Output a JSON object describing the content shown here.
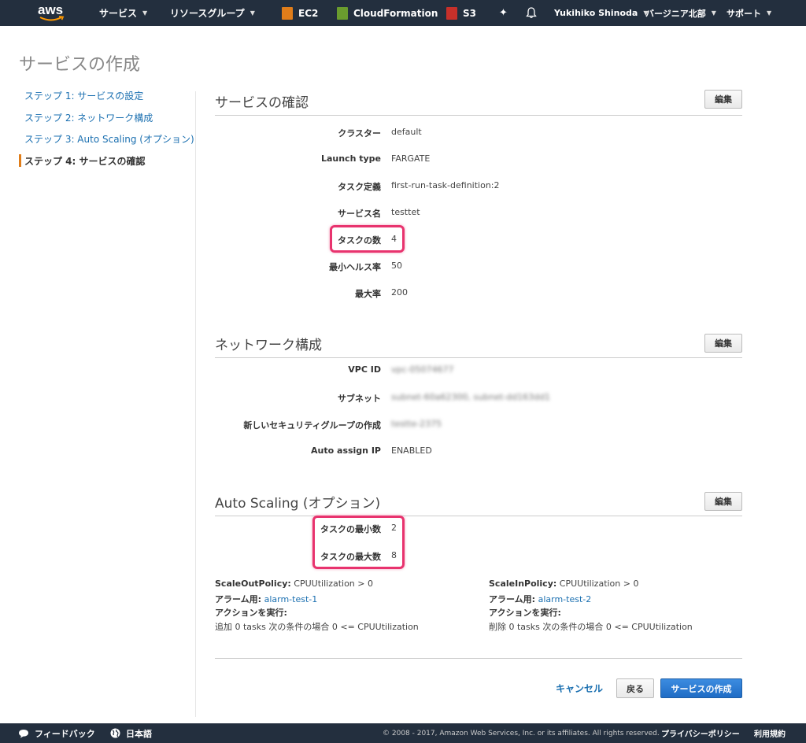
{
  "nav": {
    "logo": "aws",
    "services": "サービス",
    "resource_groups": "リソースグループ",
    "ec2": "EC2",
    "cloudformation": "CloudFormation",
    "s3": "S3",
    "user": "Yukihiko Shinoda",
    "region": "バージニア北部",
    "support": "サポート"
  },
  "page_title": "サービスの作成",
  "steps": [
    "ステップ 1: サービスの設定",
    "ステップ 2: ネットワーク構成",
    "ステップ 3: Auto Scaling (オプション)",
    "ステップ 4: サービスの確認"
  ],
  "edit_label": "編集",
  "service_review": {
    "title": "サービスの確認",
    "rows": [
      {
        "label": "クラスター",
        "value": "default"
      },
      {
        "label": "Launch type",
        "value": "FARGATE"
      },
      {
        "label": "タスク定義",
        "value": "first-run-task-definition:2"
      },
      {
        "label": "サービス名",
        "value": "testtet"
      },
      {
        "label": "タスクの数",
        "value": "4"
      },
      {
        "label": "最小ヘルス率",
        "value": "50"
      },
      {
        "label": "最大率",
        "value": "200"
      }
    ]
  },
  "network": {
    "title": "ネットワーク構成",
    "rows": [
      {
        "label": "VPC ID",
        "value": "vpc-05074677"
      },
      {
        "label": "サブネット",
        "value": "subnet-60a62300, subnet-dd163dd1"
      },
      {
        "label": "新しいセキュリティグループの作成",
        "value": "testte-2375"
      },
      {
        "label": "Auto assign IP",
        "value": "ENABLED"
      }
    ]
  },
  "autoscaling": {
    "title": "Auto Scaling (オプション)",
    "rows": [
      {
        "label": "タスクの最小数",
        "value": "2"
      },
      {
        "label": "タスクの最大数",
        "value": "8"
      }
    ],
    "scale_out": {
      "policy_label": "ScaleOutPolicy:",
      "policy_value": " CPUUtilization > 0",
      "alarm_label": "アラーム用:",
      "alarm_value": "alarm-test-1",
      "action_label": "アクションを実行:",
      "action_value": "追加 0 tasks 次の条件の場合 0 <= CPUUtilization"
    },
    "scale_in": {
      "policy_label": "ScaleInPolicy:",
      "policy_value": " CPUUtilization > 0",
      "alarm_label": "アラーム用:",
      "alarm_value": "alarm-test-2",
      "action_label": "アクションを実行:",
      "action_value": "削除 0 tasks 次の条件の場合 0 <= CPUUtilization"
    }
  },
  "actions": {
    "cancel": "キャンセル",
    "back": "戻る",
    "create": "サービスの作成"
  },
  "footer": {
    "feedback": "フィードバック",
    "language": "日本語",
    "copyright": "© 2008 - 2017, Amazon Web Services, Inc. or its affiliates. All rights reserved.",
    "privacy": "プライバシーポリシー",
    "terms": "利用規約"
  },
  "colors": {
    "nav_bg": "#232f3e",
    "link": "#1a6fb0",
    "highlight": "#e8336e",
    "primary_button": "#1f6cc5",
    "step_marker": "#e07d1a"
  }
}
